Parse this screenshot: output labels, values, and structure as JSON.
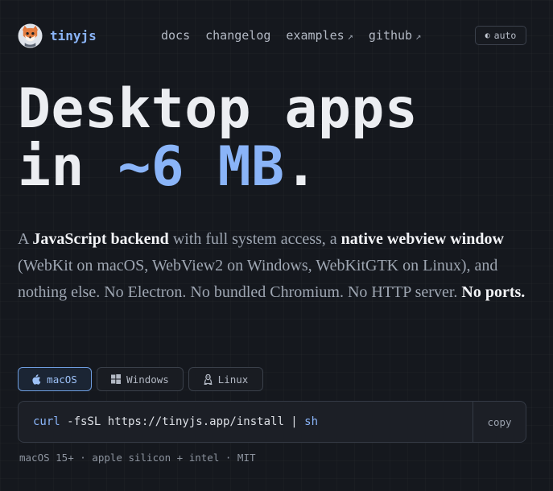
{
  "brand": {
    "name": "tinyjs",
    "logo_icon": "fox-logo-icon"
  },
  "nav": {
    "links": [
      {
        "label": "docs",
        "external": false
      },
      {
        "label": "changelog",
        "external": false
      },
      {
        "label": "examples",
        "external": true
      },
      {
        "label": "github",
        "external": true
      }
    ],
    "external_arrow": "↗",
    "theme": {
      "label": "auto",
      "icon": "◐"
    }
  },
  "hero": {
    "line1": "Desktop apps",
    "line2_prefix": "in ",
    "line2_highlight": "~6 MB",
    "line2_suffix": "."
  },
  "lede": {
    "p1": "A ",
    "b1": "JavaScript backend",
    "p2": " with full system access, a ",
    "b2": "native webview window",
    "p3": " (WebKit on macOS, WebView2 on Windows, WebKitGTK on Linux), and nothing else. No Electron. No bundled Chromium. No HTTP server. ",
    "b3": "No ports."
  },
  "os_tabs": [
    {
      "label": "macOS",
      "icon": "apple-icon",
      "active": true
    },
    {
      "label": "Windows",
      "icon": "windows-icon",
      "active": false
    },
    {
      "label": "Linux",
      "icon": "linux-icon",
      "active": false
    }
  ],
  "install": {
    "cmd_keyword": "curl",
    "cmd_args": " -fsSL https://tinyjs.app/install | ",
    "cmd_shell": "sh",
    "copy_label": "copy"
  },
  "meta": "macOS 15+ · apple silicon + intel · MIT",
  "colors": {
    "background": "#15181e",
    "accent": "#8ab4f8",
    "text": "#e6e8ec",
    "muted": "#9ea6b2"
  }
}
